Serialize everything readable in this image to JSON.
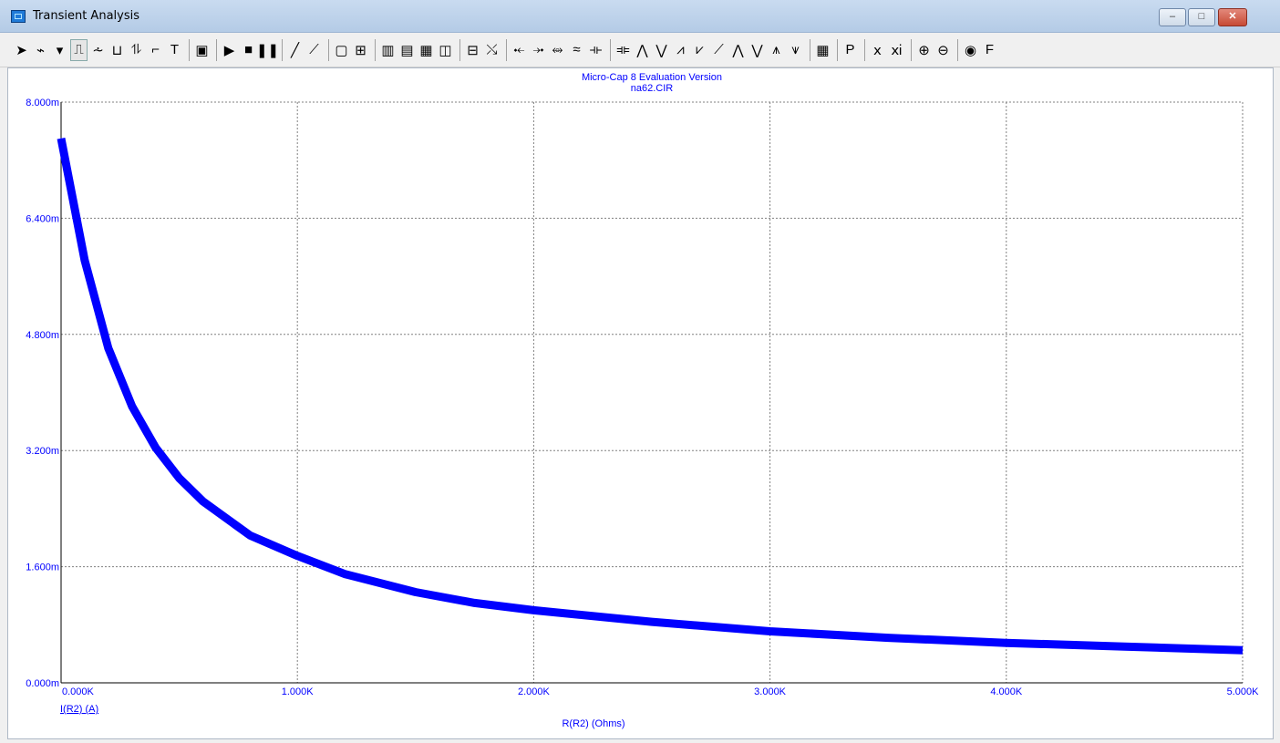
{
  "window": {
    "title": "Transient Analysis",
    "buttons": {
      "minimize": "–",
      "maximize": "□",
      "close": "✕"
    }
  },
  "toolbar": {
    "items": [
      {
        "name": "select-arrow-icon",
        "glyph": "➤"
      },
      {
        "name": "component-icon",
        "glyph": "⌁"
      },
      {
        "name": "dropdown-arrow-icon",
        "glyph": "▾"
      },
      {
        "name": "add-curve-icon",
        "glyph": "⎍"
      },
      {
        "name": "resistor-icon",
        "glyph": "⩪"
      },
      {
        "name": "bus-icon",
        "glyph": "⊔"
      },
      {
        "name": "probe-icon",
        "glyph": "⥮"
      },
      {
        "name": "wire-icon",
        "glyph": "⌐"
      },
      {
        "name": "text-icon",
        "glyph": "T"
      },
      {
        "name": "properties-icon",
        "glyph": "▣"
      },
      {
        "name": "run-icon",
        "glyph": "▶"
      },
      {
        "name": "stop-icon",
        "glyph": "■"
      },
      {
        "name": "pause-icon",
        "glyph": "❚❚"
      },
      {
        "name": "line-icon",
        "glyph": "╱"
      },
      {
        "name": "line-points-icon",
        "glyph": "⟋"
      },
      {
        "name": "frame-icon",
        "glyph": "▢"
      },
      {
        "name": "grid-icon",
        "glyph": "⊞"
      },
      {
        "name": "vertical-grid-icon",
        "glyph": "▥"
      },
      {
        "name": "horizontal-grid-icon",
        "glyph": "▤"
      },
      {
        "name": "minor-grid-icon",
        "glyph": "▦"
      },
      {
        "name": "panel-icon",
        "glyph": "◫"
      },
      {
        "name": "baseline-icon",
        "glyph": "⊟"
      },
      {
        "name": "tokens-icon",
        "glyph": "⤯"
      },
      {
        "name": "cursor-left-icon",
        "glyph": "⤝"
      },
      {
        "name": "cursor-right-icon",
        "glyph": "⤞"
      },
      {
        "name": "cursor-mode-icon",
        "glyph": "⥈"
      },
      {
        "name": "wave-icon",
        "glyph": "≈"
      },
      {
        "name": "cursor-next-icon",
        "glyph": "⟛"
      },
      {
        "name": "cursor-prev-icon",
        "glyph": "⟚"
      },
      {
        "name": "peak-icon",
        "glyph": "⋀"
      },
      {
        "name": "valley-icon",
        "glyph": "⋁"
      },
      {
        "name": "high-icon",
        "glyph": "⩘"
      },
      {
        "name": "low-icon",
        "glyph": "⩗"
      },
      {
        "name": "inflection-icon",
        "glyph": "⟋"
      },
      {
        "name": "global-high-icon",
        "glyph": "⋀"
      },
      {
        "name": "global-low-icon",
        "glyph": "⋁"
      },
      {
        "name": "top-icon",
        "glyph": "⩚"
      },
      {
        "name": "bottom-icon",
        "glyph": "⩛"
      },
      {
        "name": "table-icon",
        "glyph": "▦"
      },
      {
        "name": "point-tag-icon",
        "glyph": "P"
      },
      {
        "name": "x-scale-icon",
        "glyph": "ⅹ"
      },
      {
        "name": "y-scale-icon",
        "glyph": "ⅺ"
      },
      {
        "name": "zoom-in-icon",
        "glyph": "⊕"
      },
      {
        "name": "zoom-out-icon",
        "glyph": "⊖"
      },
      {
        "name": "colors-icon",
        "glyph": "◉"
      },
      {
        "name": "font-icon",
        "glyph": "F"
      }
    ]
  },
  "plot": {
    "title_line1": "Micro-Cap 8 Evaluation Version",
    "title_line2": "na62.CIR",
    "trace_label": "I(R2) (A)",
    "trace_color": "#0000ff"
  },
  "chart_data": {
    "type": "line",
    "title": "Micro-Cap 8 Evaluation Version na62.CIR",
    "xlabel": "R(R2) (Ohms)",
    "ylabel": "I(R2) (A)",
    "xlim": [
      0,
      5000
    ],
    "ylim": [
      0,
      0.008
    ],
    "x_tick_labels": [
      "0.000K",
      "1.000K",
      "2.000K",
      "3.000K",
      "4.000K",
      "5.000K"
    ],
    "y_tick_labels": [
      "0.000m",
      "1.600m",
      "3.200m",
      "4.800m",
      "6.400m",
      "8.000m"
    ],
    "grid": true,
    "series": [
      {
        "name": "I(R2) (A)",
        "x": [
          0,
          100,
          200,
          300,
          400,
          500,
          600,
          800,
          1000,
          1200,
          1500,
          1750,
          2000,
          2500,
          3000,
          3500,
          4000,
          4500,
          5000
        ],
        "values": [
          0.0075,
          0.00582,
          0.00461,
          0.00381,
          0.00324,
          0.00282,
          0.0025,
          0.00203,
          0.00175,
          0.0015,
          0.00125,
          0.0011,
          0.001,
          0.00084,
          0.00071,
          0.00062,
          0.00055,
          0.0005,
          0.00045
        ]
      }
    ]
  }
}
